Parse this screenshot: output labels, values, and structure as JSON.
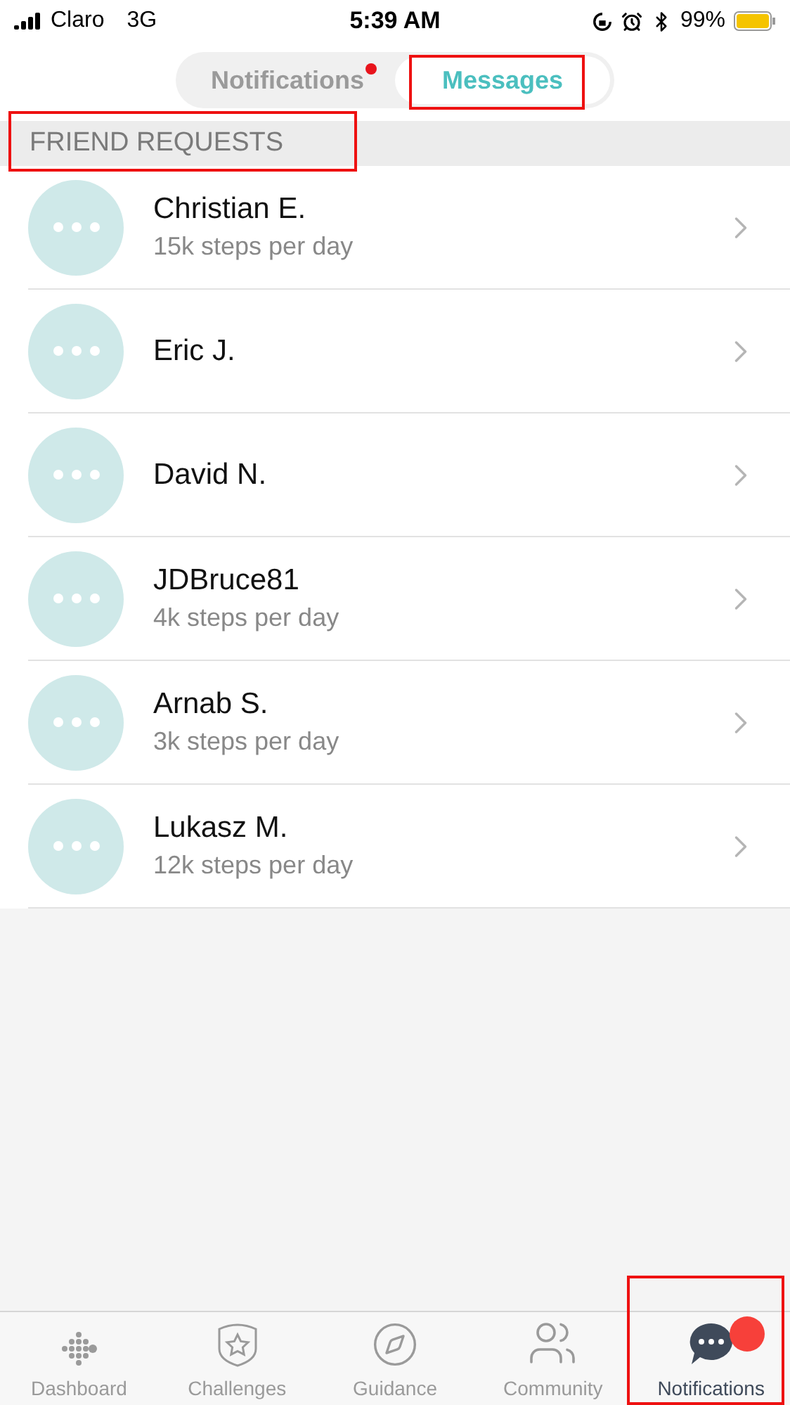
{
  "status_bar": {
    "carrier": "Claro",
    "network": "3G",
    "time": "5:39 AM",
    "battery": "99%"
  },
  "tabs": [
    {
      "label": "Notifications",
      "selected": false,
      "dot": true,
      "highlighted": false
    },
    {
      "label": "Messages",
      "selected": true,
      "dot": false,
      "highlighted": true
    }
  ],
  "section": {
    "title": "FRIEND REQUESTS",
    "highlighted": true
  },
  "requests": [
    {
      "name": "Christian E.",
      "detail": "15k steps per day"
    },
    {
      "name": "Eric J."
    },
    {
      "name": "David N."
    },
    {
      "name": "JDBruce81",
      "detail": "4k steps per day"
    },
    {
      "name": "Arnab S.",
      "detail": "3k steps per day"
    },
    {
      "name": "Lukasz M.",
      "detail": "12k steps per day"
    }
  ],
  "nav": [
    {
      "label": "Dashboard",
      "kind": "dashboard",
      "selected": false,
      "badge": false,
      "highlighted": false
    },
    {
      "label": "Challenges",
      "kind": "challenges",
      "selected": false,
      "badge": false,
      "highlighted": false
    },
    {
      "label": "Guidance",
      "kind": "guidance",
      "selected": false,
      "badge": false,
      "highlighted": false
    },
    {
      "label": "Community",
      "kind": "community",
      "selected": false,
      "badge": false,
      "highlighted": false
    },
    {
      "label": "Notifications",
      "kind": "notifications",
      "selected": true,
      "badge": true,
      "highlighted": true
    }
  ]
}
